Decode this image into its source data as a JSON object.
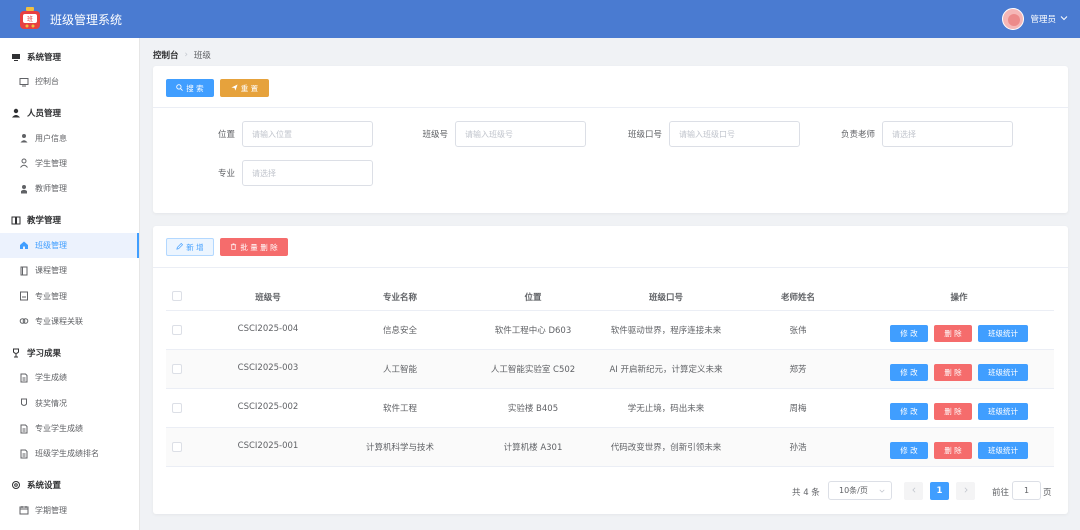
{
  "header": {
    "title": "班级管理系统",
    "user": "管理员"
  },
  "sidebar": {
    "groups": [
      {
        "label": "系统管理",
        "items": [
          {
            "label": "控制台"
          }
        ]
      },
      {
        "label": "人员管理",
        "items": [
          {
            "label": "用户信息"
          },
          {
            "label": "学生管理"
          },
          {
            "label": "教师管理"
          }
        ]
      },
      {
        "label": "教学管理",
        "items": [
          {
            "label": "班级管理"
          },
          {
            "label": "课程管理"
          },
          {
            "label": "专业管理"
          },
          {
            "label": "专业课程关联"
          }
        ]
      },
      {
        "label": "学习成果",
        "items": [
          {
            "label": "学生成绩"
          },
          {
            "label": "获奖情况"
          },
          {
            "label": "专业学生成绩"
          },
          {
            "label": "班级学生成绩排名"
          }
        ]
      },
      {
        "label": "系统设置",
        "items": [
          {
            "label": "学期管理"
          }
        ]
      }
    ]
  },
  "breadcrumb": {
    "root": "控制台",
    "current": "班级"
  },
  "search": {
    "search_btn": "搜 索",
    "reset_btn": "重 置",
    "fields": [
      {
        "label": "位置",
        "placeholder": "请输入位置"
      },
      {
        "label": "班级号",
        "placeholder": "请输入班级号"
      },
      {
        "label": "班级口号",
        "placeholder": "请输入班级口号"
      },
      {
        "label": "负责老师",
        "placeholder": "请选择"
      },
      {
        "label": "专业",
        "placeholder": "请选择"
      }
    ]
  },
  "actions": {
    "add": "新 增",
    "batch_delete": "批 量 删 除"
  },
  "table": {
    "columns": [
      "班级号",
      "专业名称",
      "位置",
      "班级口号",
      "老师姓名",
      "操作"
    ],
    "rows": [
      {
        "id": "CSCI2025-004",
        "major": "信息安全",
        "location": "软件工程中心 D603",
        "slogan": "软件驱动世界，程序连接未来",
        "teacher": "张伟"
      },
      {
        "id": "CSCI2025-003",
        "major": "人工智能",
        "location": "人工智能实验室 C502",
        "slogan": "AI 开启新纪元，计算定义未来",
        "teacher": "郑芳"
      },
      {
        "id": "CSCI2025-002",
        "major": "软件工程",
        "location": "实验楼 B405",
        "slogan": "学无止境，码出未来",
        "teacher": "周梅"
      },
      {
        "id": "CSCI2025-001",
        "major": "计算机科学与技术",
        "location": "计算机楼 A301",
        "slogan": "代码改变世界，创新引领未来",
        "teacher": "孙浩"
      }
    ],
    "op_edit": "修 改",
    "op_delete": "删 除",
    "op_stats": "班级统计"
  },
  "pagination": {
    "total": "共 4 条",
    "page_size": "10条/页",
    "current_page": "1",
    "goto_label": "前往",
    "goto_value": "1",
    "page_suffix": "页"
  },
  "colors": {
    "header": "#4a7bd1",
    "primary": "#409eff",
    "warning": "#e6a23c",
    "danger": "#f56c6c"
  }
}
